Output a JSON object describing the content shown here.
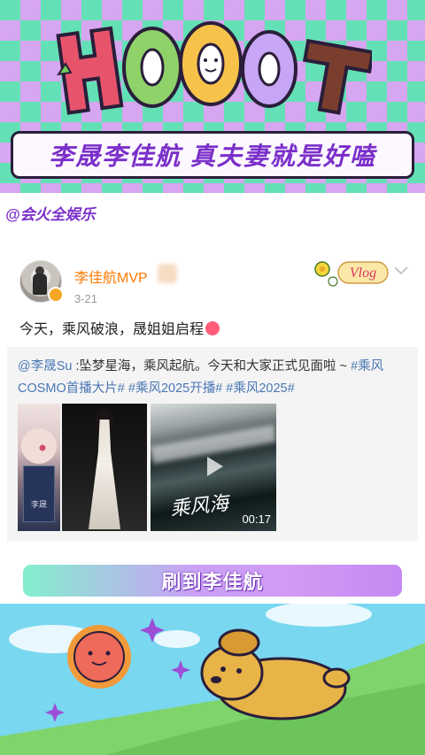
{
  "header": {
    "logo_text": "HOOOT",
    "headline": "李晟李佳航  真夫妻就是好嗑",
    "source_tag": "@会火全娱乐"
  },
  "post": {
    "username": "李佳航MVP",
    "date": "3-21",
    "vlog_sticker": "Vlog",
    "text": "今天，乘风破浪，晟姐姐启程",
    "repost": {
      "author": "@李晟Su",
      "body": " :坠梦星海，乘风起航。今天和大家正式见面啦 ~ ",
      "tags": [
        "#乘风COSMO首播大片#",
        "#乘风2025开播#",
        "#乘风2025#"
      ]
    },
    "media": {
      "thumb1_caption": "李晟",
      "thumb3_caption": "乘风海",
      "duration": "00:17"
    }
  },
  "banner": {
    "label": "刷到李佳航"
  },
  "colors": {
    "brand_purple": "#7a2fc9",
    "mint": "#64e0b6",
    "lilac": "#d7a6f0",
    "username_orange": "#ff7a00",
    "link_blue": "#4a77b4"
  }
}
